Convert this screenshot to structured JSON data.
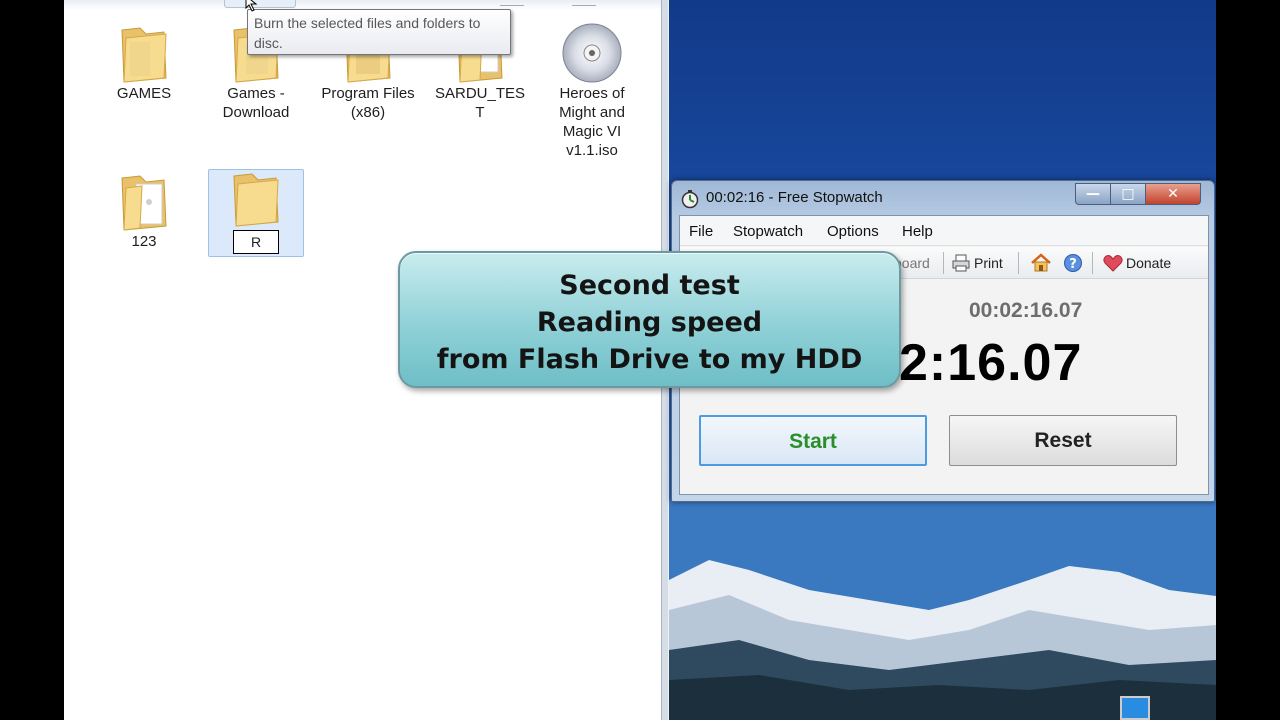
{
  "tooltip": {
    "text": "Burn the selected files and folders to disc."
  },
  "explorer": {
    "items": [
      {
        "label": "GAMES"
      },
      {
        "label": "Games - Download"
      },
      {
        "label": "Program Files (x86)"
      },
      {
        "label": "SARDU_TEST"
      },
      {
        "label": "Heroes of Might and Magic VI v1.1.iso"
      },
      {
        "label": "123"
      },
      {
        "label": "R"
      }
    ]
  },
  "stopwatch": {
    "title": "00:02:16 - Free Stopwatch",
    "menu": [
      "File",
      "Stopwatch",
      "Options",
      "Help"
    ],
    "toolbar": {
      "clipboard_fragment": "board",
      "print": "Print",
      "donate": "Donate"
    },
    "lap_time": "00:02:16.07",
    "main_time_visible": "2:16.07",
    "start_label": "Start",
    "reset_label": "Reset"
  },
  "callout": {
    "line1": "Second test",
    "line2": "Reading speed",
    "line3": "from Flash Drive to my HDD"
  },
  "colors": {
    "callout_fill": "#8fd1d7",
    "start_text": "#2a8f2a",
    "desktop_sky": "#1b4ea5"
  }
}
